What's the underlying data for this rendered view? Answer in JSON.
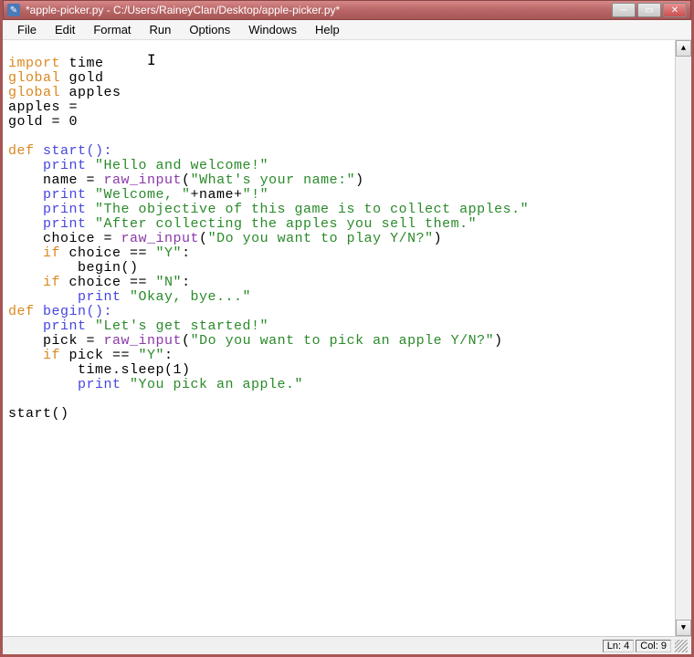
{
  "title": "*apple-picker.py - C:/Users/RaineyClan/Desktop/apple-picker.py*",
  "menu": [
    "File",
    "Edit",
    "Format",
    "Run",
    "Options",
    "Windows",
    "Help"
  ],
  "status": {
    "ln": "Ln: 4",
    "col": "Col: 9"
  },
  "code": {
    "l1_kw": "import",
    "l1_rest": " time",
    "l2_kw": "global",
    "l2_rest": " gold",
    "l3_kw": "global",
    "l3_rest": " apples",
    "l4": "apples =",
    "l5": "gold = 0",
    "l6": "",
    "l7_def": "def",
    "l7_rest": " start():",
    "l8_pr": "    print ",
    "l8_str": "\"Hello and welcome!\"",
    "l9_a": "    name = ",
    "l9_fn": "raw_input",
    "l9_b": "(",
    "l9_str": "\"What's your name:\"",
    "l9_c": ")",
    "l10_pr": "    print ",
    "l10_str1": "\"Welcome, \"",
    "l10_mid": "+name+",
    "l10_str2": "\"!\"",
    "l11_pr": "    print ",
    "l11_str": "\"The objective of this game is to collect apples.\"",
    "l12_pr": "    print ",
    "l12_str": "\"After collecting the apples you sell them.\"",
    "l13_a": "    choice = ",
    "l13_fn": "raw_input",
    "l13_b": "(",
    "l13_str": "\"Do you want to play Y/N?\"",
    "l13_c": ")",
    "l14_if": "    if",
    "l14_rest": " choice == ",
    "l14_str": "\"Y\"",
    "l14_col": ":",
    "l15": "        begin()",
    "l16_if": "    if",
    "l16_rest": " choice == ",
    "l16_str": "\"N\"",
    "l16_col": ":",
    "l17_pr": "        print ",
    "l17_str": "\"Okay, bye...\"",
    "l18_def": "def",
    "l18_rest": " begin():",
    "l19_pr": "    print ",
    "l19_str": "\"Let's get started!\"",
    "l20_a": "    pick = ",
    "l20_fn": "raw_input",
    "l20_b": "(",
    "l20_str": "\"Do you want to pick an apple Y/N?\"",
    "l20_c": ")",
    "l21_if": "    if",
    "l21_rest": " pick == ",
    "l21_str": "\"Y\"",
    "l21_col": ":",
    "l22": "        time.sleep(1)",
    "l23_pr": "        print ",
    "l23_str": "\"You pick an apple.\"",
    "l24": "",
    "l25": "start()"
  }
}
